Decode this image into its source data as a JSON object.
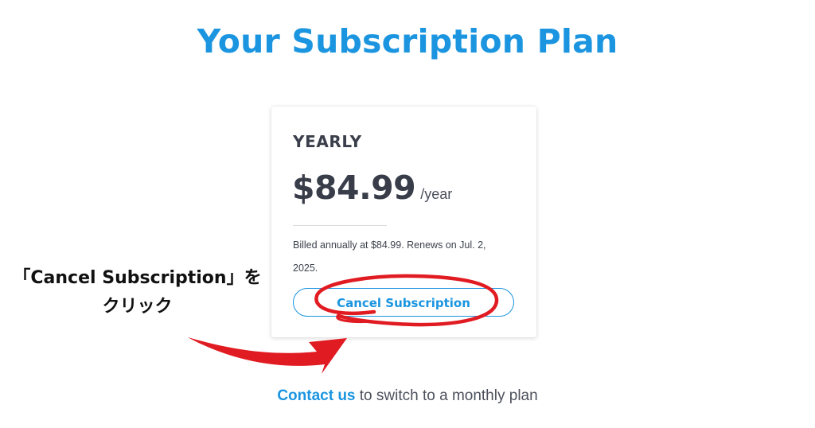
{
  "header": {
    "title": "Your Subscription Plan"
  },
  "plan": {
    "name": "YEARLY",
    "price": "$84.99",
    "period": "/year",
    "billing_note": "Billed annually at $84.99. Renews on Jul. 2, 2025.",
    "cancel_label": "Cancel Subscription"
  },
  "footer": {
    "contact_link": "Contact us",
    "rest_text": " to switch to a monthly plan"
  },
  "annotation": {
    "line1": "「Cancel Subscription」を",
    "line2": "クリック",
    "color": "#e11b22"
  },
  "colors": {
    "accent": "#1b95e0",
    "text": "#3a3f4b"
  }
}
